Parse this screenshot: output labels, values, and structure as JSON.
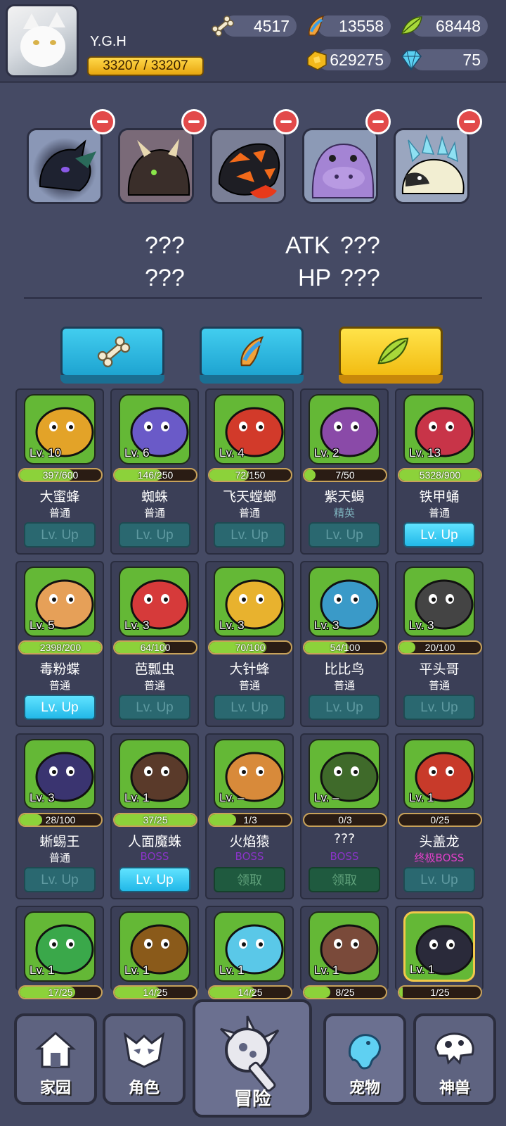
{
  "player": {
    "name": "Y.G.H",
    "hp": "33207 / 33207"
  },
  "resources": {
    "bone": "4517",
    "horn": "13558",
    "leaf": "68448",
    "gold": "629275",
    "gem": "75"
  },
  "team": {
    "slots": [
      "dark-dragon",
      "horned-beast",
      "lava-salamander",
      "purple-hippo",
      "ice-crystal-beast"
    ]
  },
  "stats": {
    "left_top": "???",
    "left_bottom": "???",
    "atk_label": "ATK",
    "atk_value": "???",
    "hp_label": "HP",
    "hp_value": "???"
  },
  "filters": [
    {
      "icon": "bone-icon",
      "active": false
    },
    {
      "icon": "horn-icon",
      "active": false
    },
    {
      "icon": "leaf-icon",
      "active": true
    }
  ],
  "pets": [
    {
      "name": "大蜜蜂",
      "level": "Lv. 10",
      "progress": "397/600",
      "fill": 0.66,
      "rarity": "普通",
      "rarity_color": "#ffffff",
      "button": "Lv. Up",
      "button_state": "dis",
      "color": "#e3a328"
    },
    {
      "name": "蜘蛛",
      "level": "Lv. 6",
      "progress": "146/250",
      "fill": 0.58,
      "rarity": "普通",
      "rarity_color": "#ffffff",
      "button": "Lv. Up",
      "button_state": "dis",
      "color": "#6a5ac8"
    },
    {
      "name": "飞天螳螂",
      "level": "Lv. 4",
      "progress": "72/150",
      "fill": 0.48,
      "rarity": "普通",
      "rarity_color": "#ffffff",
      "button": "Lv. Up",
      "button_state": "dis",
      "color": "#d23a2a"
    },
    {
      "name": "紫天蝎",
      "level": "Lv. 2",
      "progress": "7/50",
      "fill": 0.14,
      "rarity": "精英",
      "rarity_color": "#7fb4bf",
      "button": "Lv. Up",
      "button_state": "dis",
      "color": "#8a4aa8"
    },
    {
      "name": "铁甲蛹",
      "level": "Lv. 13",
      "progress": "5328/900",
      "fill": 1,
      "rarity": "普通",
      "rarity_color": "#ffffff",
      "button": "Lv. Up",
      "button_state": "on",
      "color": "#c83448"
    },
    {
      "name": "毒粉蝶",
      "level": "Lv. 5",
      "progress": "2398/200",
      "fill": 1,
      "rarity": "普通",
      "rarity_color": "#ffffff",
      "button": "Lv. Up",
      "button_state": "on",
      "color": "#e6a058"
    },
    {
      "name": "芭瓢虫",
      "level": "Lv. 3",
      "progress": "64/100",
      "fill": 0.64,
      "rarity": "普通",
      "rarity_color": "#ffffff",
      "button": "Lv. Up",
      "button_state": "dis",
      "color": "#d63a3a"
    },
    {
      "name": "大针蜂",
      "level": "Lv. 3",
      "progress": "70/100",
      "fill": 0.7,
      "rarity": "普通",
      "rarity_color": "#ffffff",
      "button": "Lv. Up",
      "button_state": "dis",
      "color": "#e8b22e"
    },
    {
      "name": "比比鸟",
      "level": "Lv. 3",
      "progress": "54/100",
      "fill": 0.54,
      "rarity": "普通",
      "rarity_color": "#ffffff",
      "button": "Lv. Up",
      "button_state": "dis",
      "color": "#3a9ac8"
    },
    {
      "name": "平头哥",
      "level": "Lv. 3",
      "progress": "20/100",
      "fill": 0.2,
      "rarity": "普通",
      "rarity_color": "#ffffff",
      "button": "Lv. Up",
      "button_state": "dis",
      "color": "#444444"
    },
    {
      "name": "蜥蜴王",
      "level": "Lv. 3",
      "progress": "28/100",
      "fill": 0.28,
      "rarity": "普通",
      "rarity_color": "#ffffff",
      "button": "Lv. Up",
      "button_state": "dis",
      "color": "#3a3470"
    },
    {
      "name": "人面魔蛛",
      "level": "Lv. 1",
      "progress": "37/25",
      "fill": 1,
      "rarity": "BOSS",
      "rarity_color": "#8a34c8",
      "button": "Lv. Up",
      "button_state": "on",
      "color": "#5a3a2a"
    },
    {
      "name": "火焰猿",
      "level": "Lv. –",
      "progress": "1/3",
      "fill": 0.33,
      "rarity": "BOSS",
      "rarity_color": "#8a34c8",
      "button": "领取",
      "button_state": "claim",
      "color": "#d88a3a"
    },
    {
      "name": "???",
      "level": "Lv. –",
      "progress": "0/3",
      "fill": 0,
      "rarity": "BOSS",
      "rarity_color": "#8a34c8",
      "button": "领取",
      "button_state": "claim",
      "color": "#3f6a2a"
    },
    {
      "name": "头盖龙",
      "level": "Lv. 1",
      "progress": "0/25",
      "fill": 0,
      "rarity": "终极BOSS",
      "rarity_color": "#e040c8",
      "button": "Lv. Up",
      "button_state": "dis",
      "color": "#c83a2a"
    },
    {
      "name": "",
      "level": "Lv. 1",
      "progress": "17/25",
      "fill": 0.68,
      "rarity": "",
      "rarity_color": "#ffffff",
      "button": "",
      "button_state": "none",
      "color": "#3aa84a"
    },
    {
      "name": "",
      "level": "Lv. 1",
      "progress": "14/25",
      "fill": 0.56,
      "rarity": "",
      "rarity_color": "#ffffff",
      "button": "",
      "button_state": "none",
      "color": "#8a5a1a"
    },
    {
      "name": "",
      "level": "Lv. 1",
      "progress": "14/25",
      "fill": 0.56,
      "rarity": "",
      "rarity_color": "#ffffff",
      "button": "",
      "button_state": "none",
      "color": "#5ac8e8"
    },
    {
      "name": "",
      "level": "Lv. 1",
      "progress": "8/25",
      "fill": 0.32,
      "rarity": "",
      "rarity_color": "#ffffff",
      "button": "",
      "button_state": "none",
      "color": "#7a4a3a"
    },
    {
      "name": "",
      "level": "Lv. 1",
      "progress": "1/25",
      "fill": 0.04,
      "rarity": "",
      "rarity_color": "#ffffff",
      "button": "",
      "button_state": "none",
      "color": "#2a2a3a"
    }
  ],
  "nav": [
    {
      "label": "家园",
      "icon": "home-icon"
    },
    {
      "label": "角色",
      "icon": "mask-icon"
    },
    {
      "label": "冒险",
      "icon": "adventure-icon"
    },
    {
      "label": "宠物",
      "icon": "pet-icon"
    },
    {
      "label": "神兽",
      "icon": "dino-skull-icon"
    }
  ]
}
